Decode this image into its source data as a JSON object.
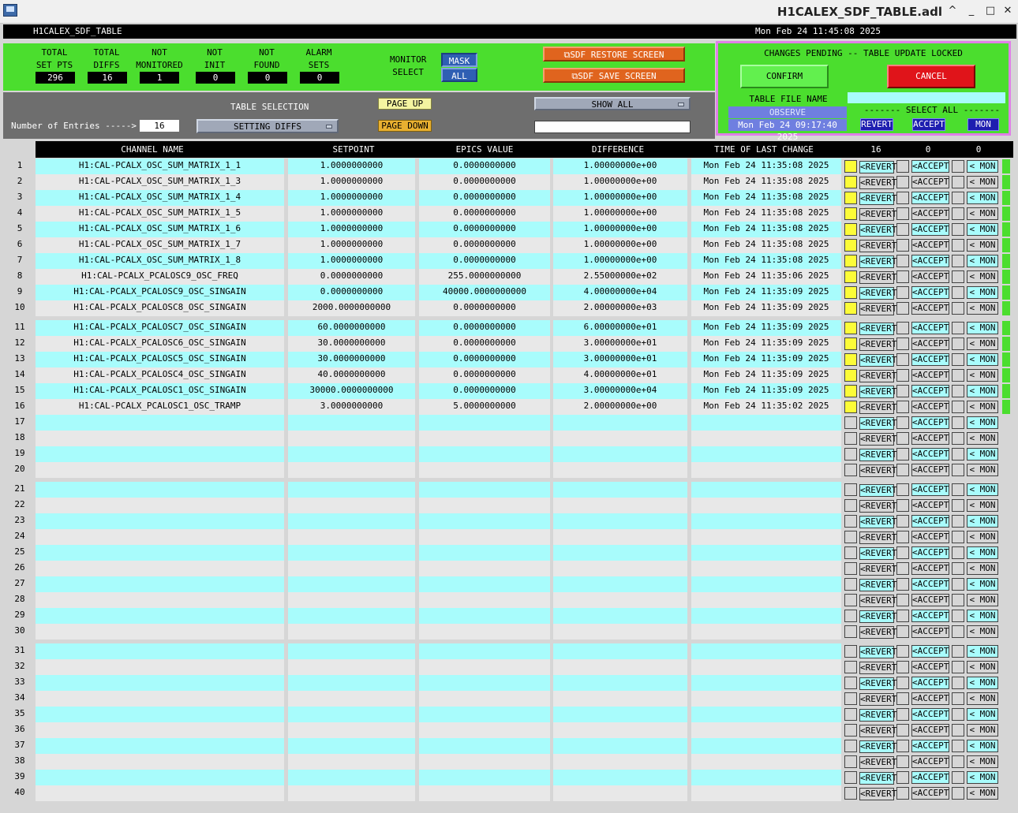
{
  "window": {
    "title": "H1CALEX_SDF_TABLE.adl",
    "controls": [
      "^",
      "_",
      "□",
      "✕"
    ]
  },
  "header": {
    "screen_name": "H1CALEX_SDF_TABLE",
    "timestamp": "Mon Feb 24 11:45:08 2025"
  },
  "stats": [
    {
      "label1": "TOTAL",
      "label2": "SET PTS",
      "value": "296"
    },
    {
      "label1": "TOTAL",
      "label2": "DIFFS",
      "value": "16"
    },
    {
      "label1": "NOT",
      "label2": "MONITORED",
      "value": "1"
    },
    {
      "label1": "NOT",
      "label2": "INIT",
      "value": "0"
    },
    {
      "label1": "NOT",
      "label2": "FOUND",
      "value": "0"
    },
    {
      "label1": "ALARM",
      "label2": "SETS",
      "value": "0"
    }
  ],
  "monitor": {
    "label1": "MONITOR",
    "label2": "SELECT",
    "mask": "MASK",
    "all": "ALL"
  },
  "screens": {
    "restore": "SDF RESTORE SCREEN",
    "save": "SDF SAVE SCREEN"
  },
  "pending": {
    "title": "CHANGES PENDING -- TABLE UPDATE LOCKED",
    "confirm": "CONFIRM",
    "cancel": "CANCEL",
    "table_file_name": "TABLE FILE NAME",
    "observe": "OBSERVE",
    "select_all": "------- SELECT ALL -------",
    "obs_date": "Mon Feb 24 09:17:40 2025",
    "revert": "REVERT",
    "accept": "ACCEPT",
    "mon": "MON"
  },
  "controls": {
    "table_selection": "TABLE SELECTION",
    "entries_label": "Number of Entries ----->",
    "entries": "16",
    "selection": "SETTING DIFFS",
    "page_up": "PAGE UP",
    "page_down": "PAGE DOWN",
    "show_all": "SHOW ALL"
  },
  "columns": {
    "channel": "CHANNEL NAME",
    "setpoint": "SETPOINT",
    "epics": "EPICS VALUE",
    "diff": "DIFFERENCE",
    "time": "TIME OF LAST CHANGE",
    "c1": "16",
    "c2": "0",
    "c3": "0"
  },
  "row_buttons": {
    "revert": "<REVERT",
    "accept": "<ACCEPT",
    "mon": "< MON"
  },
  "rows": [
    {
      "n": "1",
      "ch": "H1:CAL-PCALX_OSC_SUM_MATRIX_1_1",
      "sp": "1.0000000000",
      "ev": "0.0000000000",
      "df": "1.00000000e+00",
      "t": "Mon Feb 24 11:35:08 2025"
    },
    {
      "n": "2",
      "ch": "H1:CAL-PCALX_OSC_SUM_MATRIX_1_3",
      "sp": "1.0000000000",
      "ev": "0.0000000000",
      "df": "1.00000000e+00",
      "t": "Mon Feb 24 11:35:08 2025"
    },
    {
      "n": "3",
      "ch": "H1:CAL-PCALX_OSC_SUM_MATRIX_1_4",
      "sp": "1.0000000000",
      "ev": "0.0000000000",
      "df": "1.00000000e+00",
      "t": "Mon Feb 24 11:35:08 2025"
    },
    {
      "n": "4",
      "ch": "H1:CAL-PCALX_OSC_SUM_MATRIX_1_5",
      "sp": "1.0000000000",
      "ev": "0.0000000000",
      "df": "1.00000000e+00",
      "t": "Mon Feb 24 11:35:08 2025"
    },
    {
      "n": "5",
      "ch": "H1:CAL-PCALX_OSC_SUM_MATRIX_1_6",
      "sp": "1.0000000000",
      "ev": "0.0000000000",
      "df": "1.00000000e+00",
      "t": "Mon Feb 24 11:35:08 2025"
    },
    {
      "n": "6",
      "ch": "H1:CAL-PCALX_OSC_SUM_MATRIX_1_7",
      "sp": "1.0000000000",
      "ev": "0.0000000000",
      "df": "1.00000000e+00",
      "t": "Mon Feb 24 11:35:08 2025"
    },
    {
      "n": "7",
      "ch": "H1:CAL-PCALX_OSC_SUM_MATRIX_1_8",
      "sp": "1.0000000000",
      "ev": "0.0000000000",
      "df": "1.00000000e+00",
      "t": "Mon Feb 24 11:35:08 2025"
    },
    {
      "n": "8",
      "ch": "H1:CAL-PCALX_PCALOSC9_OSC_FREQ",
      "sp": "0.0000000000",
      "ev": "255.0000000000",
      "df": "2.55000000e+02",
      "t": "Mon Feb 24 11:35:06 2025"
    },
    {
      "n": "9",
      "ch": "H1:CAL-PCALX_PCALOSC9_OSC_SINGAIN",
      "sp": "0.0000000000",
      "ev": "40000.0000000000",
      "df": "4.00000000e+04",
      "t": "Mon Feb 24 11:35:09 2025"
    },
    {
      "n": "10",
      "ch": "H1:CAL-PCALX_PCALOSC8_OSC_SINGAIN",
      "sp": "2000.0000000000",
      "ev": "0.0000000000",
      "df": "2.00000000e+03",
      "t": "Mon Feb 24 11:35:09 2025"
    },
    {
      "n": "11",
      "ch": "H1:CAL-PCALX_PCALOSC7_OSC_SINGAIN",
      "sp": "60.0000000000",
      "ev": "0.0000000000",
      "df": "6.00000000e+01",
      "t": "Mon Feb 24 11:35:09 2025"
    },
    {
      "n": "12",
      "ch": "H1:CAL-PCALX_PCALOSC6_OSC_SINGAIN",
      "sp": "30.0000000000",
      "ev": "0.0000000000",
      "df": "3.00000000e+01",
      "t": "Mon Feb 24 11:35:09 2025"
    },
    {
      "n": "13",
      "ch": "H1:CAL-PCALX_PCALOSC5_OSC_SINGAIN",
      "sp": "30.0000000000",
      "ev": "0.0000000000",
      "df": "3.00000000e+01",
      "t": "Mon Feb 24 11:35:09 2025"
    },
    {
      "n": "14",
      "ch": "H1:CAL-PCALX_PCALOSC4_OSC_SINGAIN",
      "sp": "40.0000000000",
      "ev": "0.0000000000",
      "df": "4.00000000e+01",
      "t": "Mon Feb 24 11:35:09 2025"
    },
    {
      "n": "15",
      "ch": "H1:CAL-PCALX_PCALOSC1_OSC_SINGAIN",
      "sp": "30000.0000000000",
      "ev": "0.0000000000",
      "df": "3.00000000e+04",
      "t": "Mon Feb 24 11:35:09 2025"
    },
    {
      "n": "16",
      "ch": "H1:CAL-PCALX_PCALOSC1_OSC_TRAMP",
      "sp": "3.0000000000",
      "ev": "5.0000000000",
      "df": "2.00000000e+00",
      "t": "Mon Feb 24 11:35:02 2025"
    },
    {
      "n": "17"
    },
    {
      "n": "18"
    },
    {
      "n": "19"
    },
    {
      "n": "20"
    },
    {
      "n": "21"
    },
    {
      "n": "22"
    },
    {
      "n": "23"
    },
    {
      "n": "24"
    },
    {
      "n": "25"
    },
    {
      "n": "26"
    },
    {
      "n": "27"
    },
    {
      "n": "28"
    },
    {
      "n": "29"
    },
    {
      "n": "30"
    },
    {
      "n": "31"
    },
    {
      "n": "32"
    },
    {
      "n": "33"
    },
    {
      "n": "34"
    },
    {
      "n": "35"
    },
    {
      "n": "36"
    },
    {
      "n": "37"
    },
    {
      "n": "38"
    },
    {
      "n": "39"
    },
    {
      "n": "40"
    }
  ],
  "colors": {
    "cyan": "#a8fcfc",
    "light": "#e8e8e8",
    "accent": "#4bde2e",
    "pending": "#fcfc38"
  }
}
